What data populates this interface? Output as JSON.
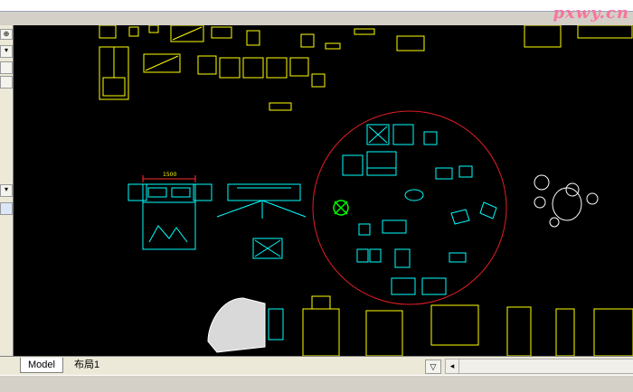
{
  "watermark": {
    "text": "pxwy.cn"
  },
  "left_panel": {
    "buttons": [
      "⊕",
      "▾",
      "",
      "",
      "▾",
      ""
    ]
  },
  "tabs": [
    {
      "label": "Model"
    },
    {
      "label": "布局1"
    }
  ],
  "hscroll": {
    "left_arrow": "◂"
  },
  "tab_nav": {
    "symbol": "▽"
  },
  "drawing": {
    "dimension_label": "1500",
    "colors": {
      "furniture": "#ffff00",
      "cyan": "#00ffff",
      "circle": "#e31e24",
      "plant": "#00ff00",
      "white": "#ffffff",
      "red_dim": "#ff3030"
    }
  }
}
